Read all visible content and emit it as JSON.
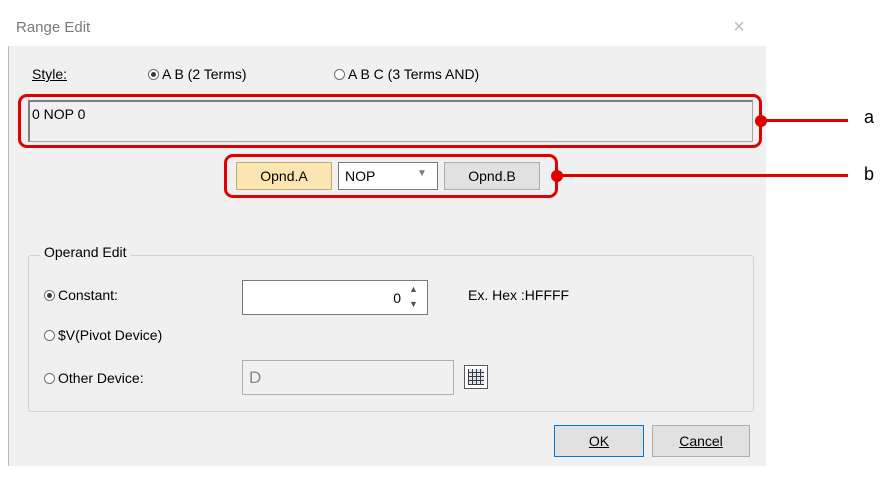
{
  "window": {
    "title": "Range Edit",
    "close_label": "×"
  },
  "style": {
    "label": "Style:",
    "options": [
      {
        "label": "A B (2 Terms)",
        "checked": true
      },
      {
        "label": "A B C (3 Terms AND)",
        "checked": false
      }
    ]
  },
  "expression": {
    "value": "0 NOP 0"
  },
  "operator_bar": {
    "opnd_a_label": "Opnd.A",
    "operator_value": "NOP",
    "opnd_b_label": "Opnd.B"
  },
  "annotations": {
    "a": "a",
    "b": "b",
    "color": "#e00000"
  },
  "operand_edit": {
    "title": "Operand Edit",
    "constant_label": "Constant:",
    "constant_value": "0",
    "hex_example": "Ex. Hex :HFFFF",
    "pivot_label": "$V(Pivot Device)",
    "other_device_label": "Other Device:",
    "other_device_value": "D",
    "selected": "Constant"
  },
  "buttons": {
    "ok": "OK",
    "cancel": "Cancel"
  }
}
